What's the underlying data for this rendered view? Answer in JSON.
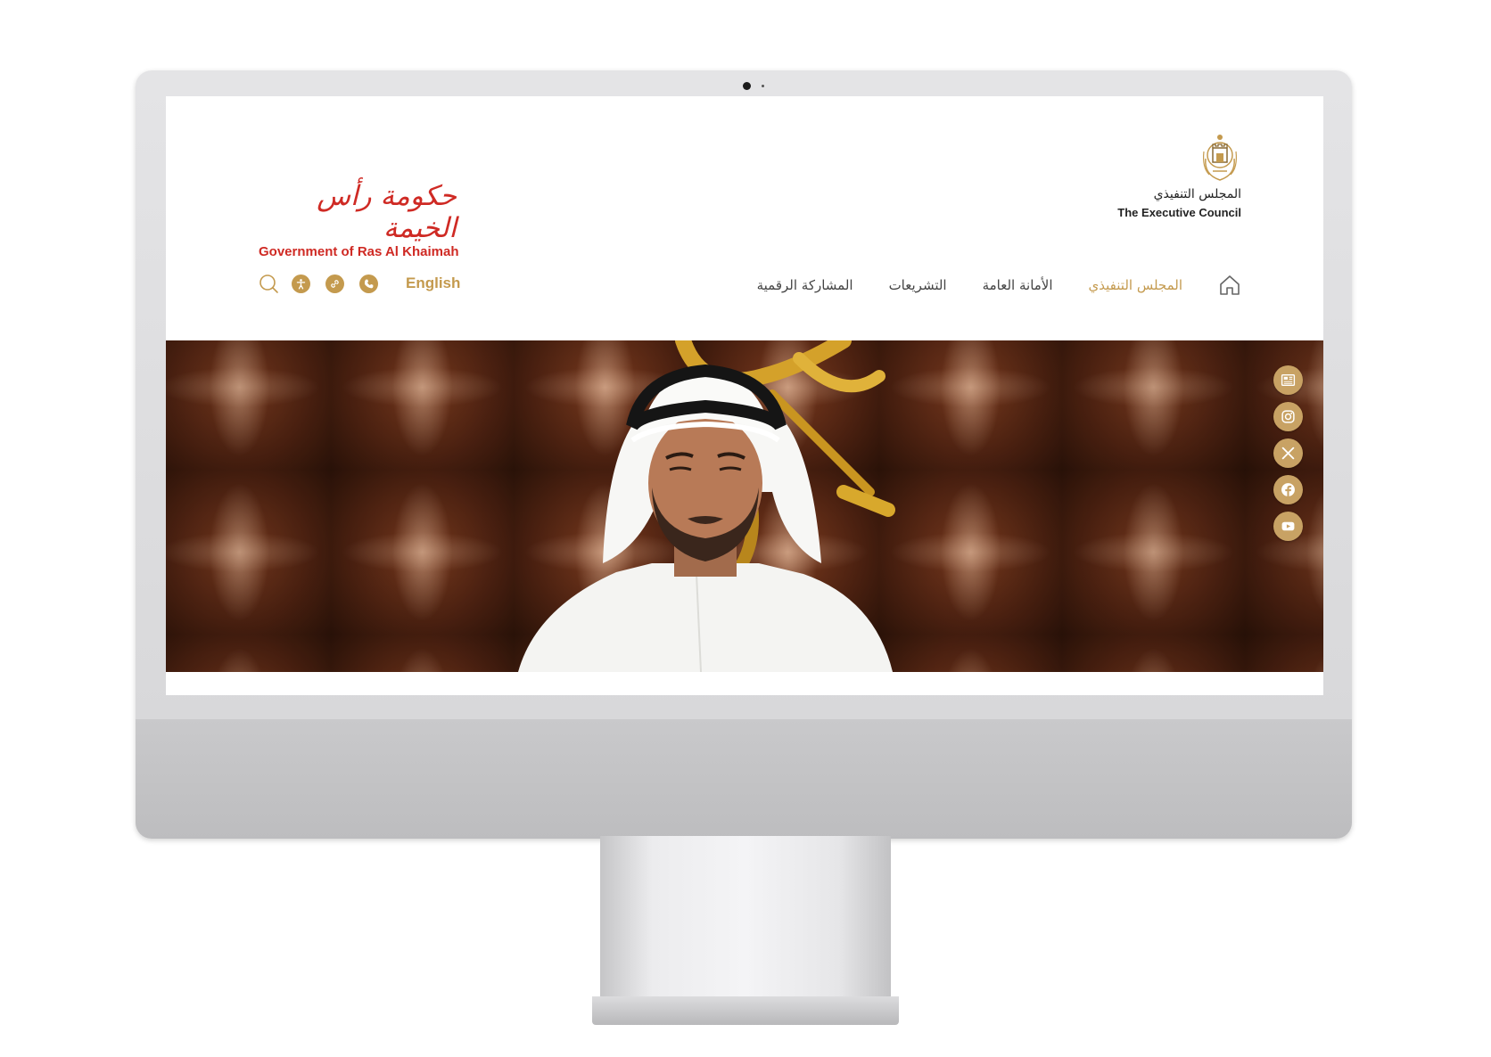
{
  "header": {
    "gov_logo": {
      "arabic": "حكومة رأس الخيمة",
      "english": "Government of Ras Al Khaimah"
    },
    "council_logo": {
      "arabic": "المجلس التنفيذي",
      "english": "The Executive Council"
    }
  },
  "utilities": {
    "language_label": "English",
    "icons": [
      "search-icon",
      "accessibility-icon",
      "link-icon",
      "phone-icon"
    ]
  },
  "nav": {
    "home_icon": "home-icon",
    "items": [
      {
        "label": "المجلس التنفيذي",
        "active": true
      },
      {
        "label": "الأمانة العامة",
        "active": false
      },
      {
        "label": "التشريعات",
        "active": false
      },
      {
        "label": "المشاركة الرقمية",
        "active": false
      }
    ]
  },
  "hero": {
    "social": [
      "news-icon",
      "instagram-icon",
      "x-icon",
      "facebook-icon",
      "youtube-icon"
    ]
  },
  "colors": {
    "accent": "#c49a4e",
    "brand_red": "#cf2a24",
    "nav_text": "#444444"
  }
}
